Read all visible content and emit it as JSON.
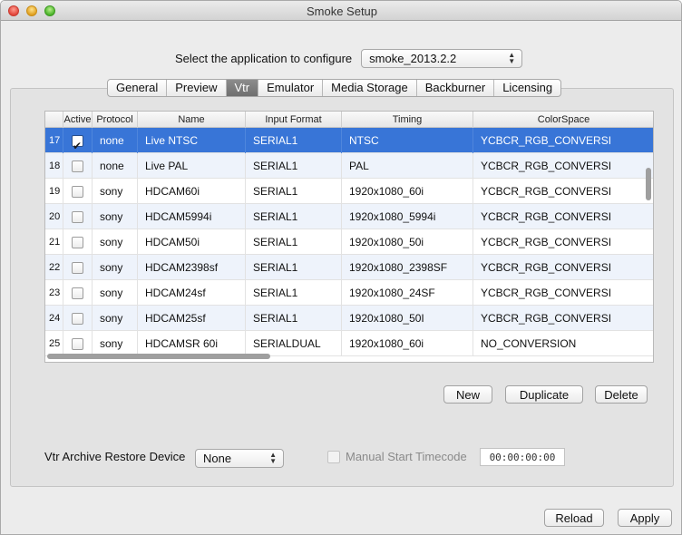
{
  "window": {
    "title": "Smoke Setup"
  },
  "app_select": {
    "label": "Select the application to configure",
    "value": "smoke_2013.2.2"
  },
  "tabs": [
    {
      "label": "General",
      "active": false
    },
    {
      "label": "Preview",
      "active": false
    },
    {
      "label": "Vtr",
      "active": true
    },
    {
      "label": "Emulator",
      "active": false
    },
    {
      "label": "Media Storage",
      "active": false
    },
    {
      "label": "Backburner",
      "active": false
    },
    {
      "label": "Licensing",
      "active": false
    }
  ],
  "table": {
    "columns": [
      "",
      "Active",
      "Protocol",
      "Name",
      "Input Format",
      "Timing",
      "ColorSpace"
    ],
    "rows": [
      {
        "num": "17",
        "active": true,
        "protocol": "none",
        "name": "Live NTSC",
        "input": "SERIAL1",
        "timing": "NTSC",
        "colorspace": "YCBCR_RGB_CONVERSI",
        "selected": true
      },
      {
        "num": "18",
        "active": false,
        "protocol": "none",
        "name": "Live PAL",
        "input": "SERIAL1",
        "timing": "PAL",
        "colorspace": "YCBCR_RGB_CONVERSI"
      },
      {
        "num": "19",
        "active": false,
        "protocol": "sony",
        "name": "HDCAM60i",
        "input": "SERIAL1",
        "timing": "1920x1080_60i",
        "colorspace": "YCBCR_RGB_CONVERSI"
      },
      {
        "num": "20",
        "active": false,
        "protocol": "sony",
        "name": "HDCAM5994i",
        "input": "SERIAL1",
        "timing": "1920x1080_5994i",
        "colorspace": "YCBCR_RGB_CONVERSI"
      },
      {
        "num": "21",
        "active": false,
        "protocol": "sony",
        "name": "HDCAM50i",
        "input": "SERIAL1",
        "timing": "1920x1080_50i",
        "colorspace": "YCBCR_RGB_CONVERSI"
      },
      {
        "num": "22",
        "active": false,
        "protocol": "sony",
        "name": "HDCAM2398sf",
        "input": "SERIAL1",
        "timing": "1920x1080_2398SF",
        "colorspace": "YCBCR_RGB_CONVERSI"
      },
      {
        "num": "23",
        "active": false,
        "protocol": "sony",
        "name": "HDCAM24sf",
        "input": "SERIAL1",
        "timing": "1920x1080_24SF",
        "colorspace": "YCBCR_RGB_CONVERSI"
      },
      {
        "num": "24",
        "active": false,
        "protocol": "sony",
        "name": "HDCAM25sf",
        "input": "SERIAL1",
        "timing": "1920x1080_50I",
        "colorspace": "YCBCR_RGB_CONVERSI"
      },
      {
        "num": "25",
        "active": false,
        "protocol": "sony",
        "name": "HDCAMSR 60i",
        "input": "SERIALDUAL",
        "timing": "1920x1080_60i",
        "colorspace": "NO_CONVERSION"
      }
    ]
  },
  "table_buttons": {
    "new": "New",
    "duplicate": "Duplicate",
    "delete": "Delete"
  },
  "archive": {
    "label": "Vtr Archive Restore Device",
    "value": "None"
  },
  "manual_timecode": {
    "label": "Manual Start Timecode",
    "checked": false,
    "value": "00:00:00:00"
  },
  "footer": {
    "reload": "Reload",
    "apply": "Apply"
  },
  "colors": {
    "selection": "#3875d7",
    "alt_row": "#eef3fb"
  }
}
